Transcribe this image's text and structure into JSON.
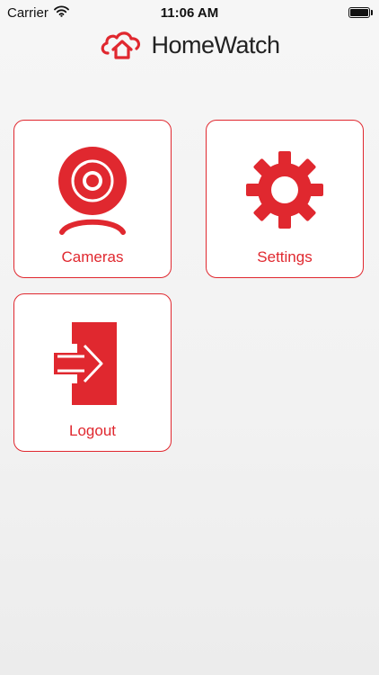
{
  "status_bar": {
    "carrier": "Carrier",
    "time": "11:06 AM",
    "wifi_icon": "wifi-icon",
    "battery_icon": "battery-icon"
  },
  "header": {
    "title": "HomeWatch",
    "logo_icon": "cloud-home-icon"
  },
  "colors": {
    "accent": "#e0282f",
    "background": "#f4f4f4",
    "tile_background": "#ffffff"
  },
  "tiles": [
    {
      "label": "Cameras",
      "icon": "webcam-icon"
    },
    {
      "label": "Settings",
      "icon": "gear-icon"
    },
    {
      "label": "Logout",
      "icon": "logout-icon"
    }
  ]
}
